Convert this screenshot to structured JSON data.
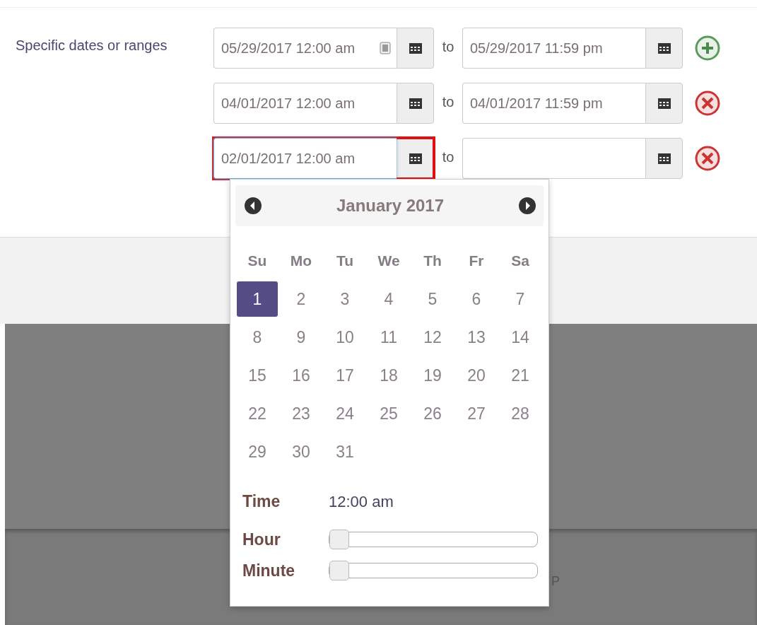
{
  "field_label": "Specific dates or ranges",
  "ranges": [
    {
      "start": "05/29/2017 12:00 am",
      "autofill_badge": true,
      "focused": false,
      "highlighted": false,
      "separator": "to",
      "end": "05/29/2017 11:59 pm",
      "kind": "add"
    },
    {
      "start": "04/01/2017 12:00 am",
      "autofill_badge": false,
      "focused": false,
      "highlighted": false,
      "separator": "to",
      "end": "04/01/2017 11:59 pm",
      "kind": "remove"
    },
    {
      "start": "02/01/2017 12:00 am",
      "autofill_badge": false,
      "focused": true,
      "highlighted": true,
      "separator": "to",
      "kind": "remove"
    }
  ],
  "datepicker": {
    "month": "January 2017",
    "weekdays": [
      "Su",
      "Mo",
      "Tu",
      "We",
      "Th",
      "Fr",
      "Sa"
    ],
    "days": [
      {
        "label": "1",
        "selected": true
      },
      {
        "label": "2",
        "selected": false
      },
      {
        "label": "3",
        "selected": false
      },
      {
        "label": "4",
        "selected": false
      },
      {
        "label": "5",
        "selected": false
      },
      {
        "label": "6",
        "selected": false
      },
      {
        "label": "7",
        "selected": false
      },
      {
        "label": "8",
        "selected": false
      },
      {
        "label": "9",
        "selected": false
      },
      {
        "label": "10",
        "selected": false
      },
      {
        "label": "11",
        "selected": false
      },
      {
        "label": "12",
        "selected": false
      },
      {
        "label": "13",
        "selected": false
      },
      {
        "label": "14",
        "selected": false
      },
      {
        "label": "15",
        "selected": false
      },
      {
        "label": "16",
        "selected": false
      },
      {
        "label": "17",
        "selected": false
      },
      {
        "label": "18",
        "selected": false
      },
      {
        "label": "19",
        "selected": false
      },
      {
        "label": "20",
        "selected": false
      },
      {
        "label": "21",
        "selected": false
      },
      {
        "label": "22",
        "selected": false
      },
      {
        "label": "23",
        "selected": false
      },
      {
        "label": "24",
        "selected": false
      },
      {
        "label": "25",
        "selected": false
      },
      {
        "label": "26",
        "selected": false
      },
      {
        "label": "27",
        "selected": false
      },
      {
        "label": "28",
        "selected": false
      },
      {
        "label": "29",
        "selected": false
      },
      {
        "label": "30",
        "selected": false
      },
      {
        "label": "31",
        "selected": false
      }
    ],
    "time_label": "Time",
    "time_value": "12:00 am",
    "sliders": [
      {
        "label": "Hour",
        "level": 0
      },
      {
        "label": "Minute",
        "level": 0
      }
    ]
  },
  "footer_fragment": "P"
}
